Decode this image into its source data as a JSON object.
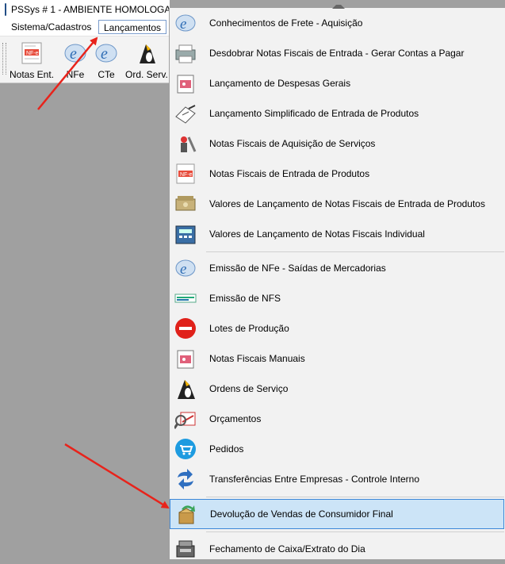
{
  "window": {
    "title": "PSSys # 1 - AMBIENTE HOMOLOGA"
  },
  "menubar": {
    "items": [
      "Sistema/Cadastros",
      "Lançamentos"
    ]
  },
  "toolbar": {
    "buttons": [
      {
        "label": "Notas Ent.",
        "icon": "nfe-document-icon"
      },
      {
        "label": "NFe",
        "icon": "nfe-e-icon"
      },
      {
        "label": "CTe",
        "icon": "cte-e-icon"
      },
      {
        "label": "Ord. Serv.",
        "icon": "penguin-icon"
      }
    ]
  },
  "dropdown": {
    "items": [
      "Conhecimentos de Frete - Aquisição",
      "Desdobrar Notas Fiscais de Entrada - Gerar Contas a Pagar",
      "Lançamento de Despesas Gerais",
      "Lançamento Simplificado de Entrada de Produtos",
      "Notas Fiscais de Aquisição de Serviços",
      "Notas Fiscais de Entrada de Produtos",
      "Valores de Lançamento de Notas Fiscais de Entrada de Produtos",
      "Valores de Lançamento de Notas Fiscais Individual",
      "Emissão de NFe - Saídas de Mercadorias",
      "Emissão de NFS",
      "Lotes de Produção",
      "Notas Fiscais Manuais",
      "Ordens de Serviço",
      "Orçamentos",
      "Pedidos",
      "Transferências Entre Empresas - Controle Interno",
      "Devolução de Vendas de Consumidor Final",
      "Fechamento de Caixa/Extrato do Dia"
    ],
    "selected_index": 16
  },
  "colors": {
    "selection_bg": "#cce4f7",
    "selection_border": "#3d88d8",
    "annotation_arrow": "#e8231b"
  }
}
